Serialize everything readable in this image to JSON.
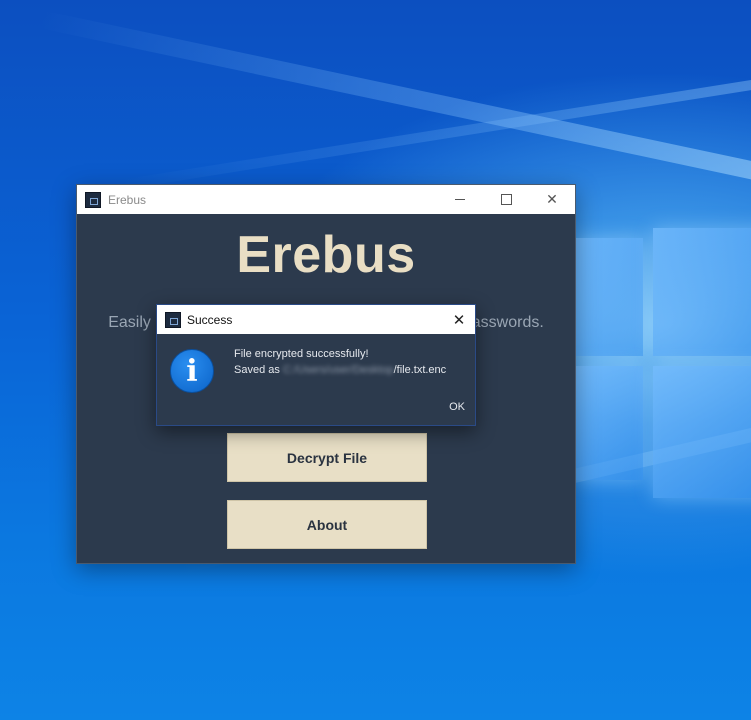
{
  "app_window": {
    "title": "Erebus",
    "heading": "Erebus",
    "subtitle_left": "Easily",
    "subtitle_right": "asswords.",
    "buttons": {
      "decrypt_label": "Decrypt File",
      "about_label": "About"
    },
    "controls": {
      "minimize_icon": "minimize-icon",
      "maximize_icon": "maximize-icon",
      "close_glyph": "✕"
    }
  },
  "dialog": {
    "title": "Success",
    "close_glyph": "✕",
    "icon": "info-icon",
    "icon_glyph": "i",
    "message_line1": "File encrypted successfully!",
    "saved_prefix": "Saved as",
    "saved_path_blurred": "C:/Users/user/Desktop",
    "saved_filename": "/file.txt.enc",
    "ok_label": "OK"
  },
  "colors": {
    "window_bg": "#2c3a4d",
    "heading": "#e9dec4",
    "button_bg": "#e8dfc6",
    "info_icon": "#0b63c8"
  }
}
